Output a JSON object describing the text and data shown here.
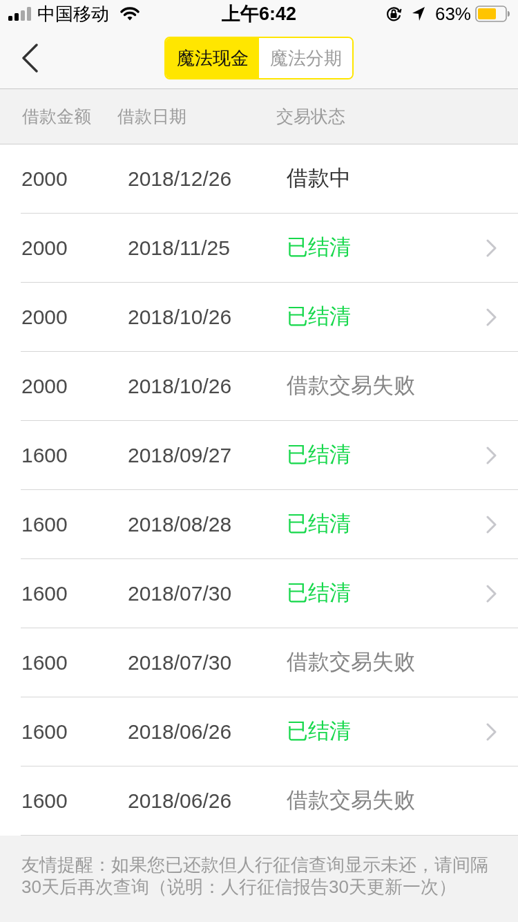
{
  "status_bar": {
    "carrier": "中国移动",
    "time": "上午6:42",
    "battery": "63%"
  },
  "tabs": [
    {
      "label": "魔法现金",
      "selected": true
    },
    {
      "label": "魔法分期",
      "selected": false
    }
  ],
  "table": {
    "columns": [
      "借款金额",
      "借款日期",
      "交易状态"
    ],
    "rows": [
      {
        "amount": "2000",
        "date": "2018/12/26",
        "status": "借款中",
        "kind": "in_progress"
      },
      {
        "amount": "2000",
        "date": "2018/11/25",
        "status": "已结清",
        "kind": "settled"
      },
      {
        "amount": "2000",
        "date": "2018/10/26",
        "status": "已结清",
        "kind": "settled"
      },
      {
        "amount": "2000",
        "date": "2018/10/26",
        "status": "借款交易失败",
        "kind": "failed"
      },
      {
        "amount": "1600",
        "date": "2018/09/27",
        "status": "已结清",
        "kind": "settled"
      },
      {
        "amount": "1600",
        "date": "2018/08/28",
        "status": "已结清",
        "kind": "settled"
      },
      {
        "amount": "1600",
        "date": "2018/07/30",
        "status": "已结清",
        "kind": "settled"
      },
      {
        "amount": "1600",
        "date": "2018/07/30",
        "status": "借款交易失败",
        "kind": "failed"
      },
      {
        "amount": "1600",
        "date": "2018/06/26",
        "status": "已结清",
        "kind": "settled"
      },
      {
        "amount": "1600",
        "date": "2018/06/26",
        "status": "借款交易失败",
        "kind": "failed"
      }
    ]
  },
  "notice": "友情提醒：如果您已还款但人行征信查询显示未还，请间隔30天后再次查询（说明：人行征信报告30天更新一次）"
}
